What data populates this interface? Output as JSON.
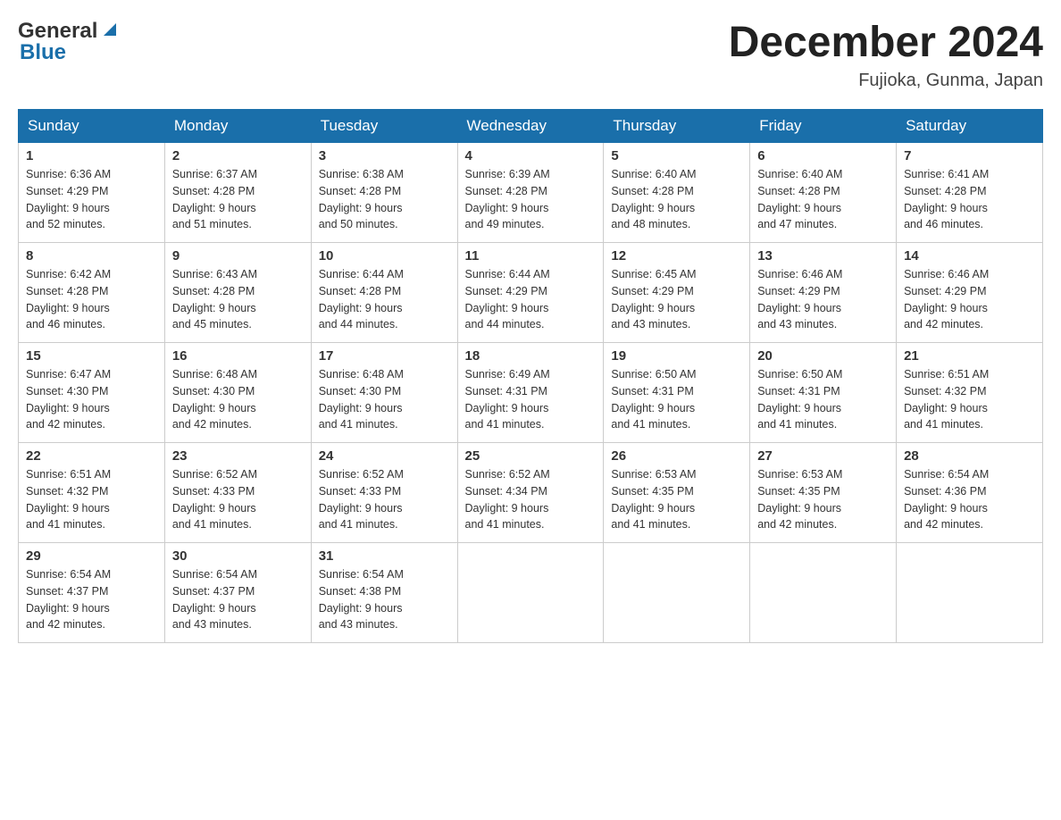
{
  "logo": {
    "text_general": "General",
    "text_blue": "Blue"
  },
  "header": {
    "month_year": "December 2024",
    "location": "Fujioka, Gunma, Japan"
  },
  "days_of_week": [
    "Sunday",
    "Monday",
    "Tuesday",
    "Wednesday",
    "Thursday",
    "Friday",
    "Saturday"
  ],
  "weeks": [
    [
      {
        "day": "1",
        "sunrise": "6:36 AM",
        "sunset": "4:29 PM",
        "daylight": "9 hours and 52 minutes."
      },
      {
        "day": "2",
        "sunrise": "6:37 AM",
        "sunset": "4:28 PM",
        "daylight": "9 hours and 51 minutes."
      },
      {
        "day": "3",
        "sunrise": "6:38 AM",
        "sunset": "4:28 PM",
        "daylight": "9 hours and 50 minutes."
      },
      {
        "day": "4",
        "sunrise": "6:39 AM",
        "sunset": "4:28 PM",
        "daylight": "9 hours and 49 minutes."
      },
      {
        "day": "5",
        "sunrise": "6:40 AM",
        "sunset": "4:28 PM",
        "daylight": "9 hours and 48 minutes."
      },
      {
        "day": "6",
        "sunrise": "6:40 AM",
        "sunset": "4:28 PM",
        "daylight": "9 hours and 47 minutes."
      },
      {
        "day": "7",
        "sunrise": "6:41 AM",
        "sunset": "4:28 PM",
        "daylight": "9 hours and 46 minutes."
      }
    ],
    [
      {
        "day": "8",
        "sunrise": "6:42 AM",
        "sunset": "4:28 PM",
        "daylight": "9 hours and 46 minutes."
      },
      {
        "day": "9",
        "sunrise": "6:43 AM",
        "sunset": "4:28 PM",
        "daylight": "9 hours and 45 minutes."
      },
      {
        "day": "10",
        "sunrise": "6:44 AM",
        "sunset": "4:28 PM",
        "daylight": "9 hours and 44 minutes."
      },
      {
        "day": "11",
        "sunrise": "6:44 AM",
        "sunset": "4:29 PM",
        "daylight": "9 hours and 44 minutes."
      },
      {
        "day": "12",
        "sunrise": "6:45 AM",
        "sunset": "4:29 PM",
        "daylight": "9 hours and 43 minutes."
      },
      {
        "day": "13",
        "sunrise": "6:46 AM",
        "sunset": "4:29 PM",
        "daylight": "9 hours and 43 minutes."
      },
      {
        "day": "14",
        "sunrise": "6:46 AM",
        "sunset": "4:29 PM",
        "daylight": "9 hours and 42 minutes."
      }
    ],
    [
      {
        "day": "15",
        "sunrise": "6:47 AM",
        "sunset": "4:30 PM",
        "daylight": "9 hours and 42 minutes."
      },
      {
        "day": "16",
        "sunrise": "6:48 AM",
        "sunset": "4:30 PM",
        "daylight": "9 hours and 42 minutes."
      },
      {
        "day": "17",
        "sunrise": "6:48 AM",
        "sunset": "4:30 PM",
        "daylight": "9 hours and 41 minutes."
      },
      {
        "day": "18",
        "sunrise": "6:49 AM",
        "sunset": "4:31 PM",
        "daylight": "9 hours and 41 minutes."
      },
      {
        "day": "19",
        "sunrise": "6:50 AM",
        "sunset": "4:31 PM",
        "daylight": "9 hours and 41 minutes."
      },
      {
        "day": "20",
        "sunrise": "6:50 AM",
        "sunset": "4:31 PM",
        "daylight": "9 hours and 41 minutes."
      },
      {
        "day": "21",
        "sunrise": "6:51 AM",
        "sunset": "4:32 PM",
        "daylight": "9 hours and 41 minutes."
      }
    ],
    [
      {
        "day": "22",
        "sunrise": "6:51 AM",
        "sunset": "4:32 PM",
        "daylight": "9 hours and 41 minutes."
      },
      {
        "day": "23",
        "sunrise": "6:52 AM",
        "sunset": "4:33 PM",
        "daylight": "9 hours and 41 minutes."
      },
      {
        "day": "24",
        "sunrise": "6:52 AM",
        "sunset": "4:33 PM",
        "daylight": "9 hours and 41 minutes."
      },
      {
        "day": "25",
        "sunrise": "6:52 AM",
        "sunset": "4:34 PM",
        "daylight": "9 hours and 41 minutes."
      },
      {
        "day": "26",
        "sunrise": "6:53 AM",
        "sunset": "4:35 PM",
        "daylight": "9 hours and 41 minutes."
      },
      {
        "day": "27",
        "sunrise": "6:53 AM",
        "sunset": "4:35 PM",
        "daylight": "9 hours and 42 minutes."
      },
      {
        "day": "28",
        "sunrise": "6:54 AM",
        "sunset": "4:36 PM",
        "daylight": "9 hours and 42 minutes."
      }
    ],
    [
      {
        "day": "29",
        "sunrise": "6:54 AM",
        "sunset": "4:37 PM",
        "daylight": "9 hours and 42 minutes."
      },
      {
        "day": "30",
        "sunrise": "6:54 AM",
        "sunset": "4:37 PM",
        "daylight": "9 hours and 43 minutes."
      },
      {
        "day": "31",
        "sunrise": "6:54 AM",
        "sunset": "4:38 PM",
        "daylight": "9 hours and 43 minutes."
      },
      null,
      null,
      null,
      null
    ]
  ],
  "labels": {
    "sunrise": "Sunrise:",
    "sunset": "Sunset:",
    "daylight": "Daylight:"
  }
}
